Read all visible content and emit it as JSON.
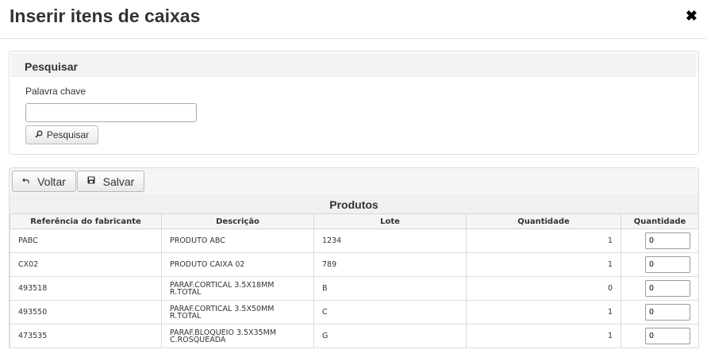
{
  "modal": {
    "title": "Inserir itens de caixas",
    "close_symbol": "✖"
  },
  "search": {
    "panel_title": "Pesquisar",
    "keyword_label": "Palavra chave",
    "keyword_value": "",
    "button_label": "Pesquisar",
    "button_icon": "search-icon"
  },
  "toolbar": {
    "back_label": "Voltar",
    "back_icon": "back-arrow-icon",
    "save_label": "Salvar",
    "save_icon": "floppy-disk-icon"
  },
  "products": {
    "caption": "Produtos",
    "columns": [
      "Referência do fabricante",
      "Descrição",
      "Lote",
      "Quantidade",
      "Quantidade"
    ],
    "rows": [
      {
        "ref": "PABC",
        "desc": "PRODUTO ABC",
        "lote": "1234",
        "quantidade": "1",
        "input": "0"
      },
      {
        "ref": "CX02",
        "desc": "PRODUTO CAIXA 02",
        "lote": "789",
        "quantidade": "1",
        "input": "0"
      },
      {
        "ref": "493518",
        "desc": "PARAF.CORTICAL 3.5X18MM R.TOTAL",
        "lote": "B",
        "quantidade": "0",
        "input": "0"
      },
      {
        "ref": "493550",
        "desc": "PARAF.CORTICAL 3.5X50MM R.TOTAL",
        "lote": "C",
        "quantidade": "1",
        "input": "0"
      },
      {
        "ref": "473535",
        "desc": "PARAF.BLOQUEIO 3.5X35MM C.ROSQUEADA",
        "lote": "G",
        "quantidade": "1",
        "input": "0"
      }
    ]
  }
}
